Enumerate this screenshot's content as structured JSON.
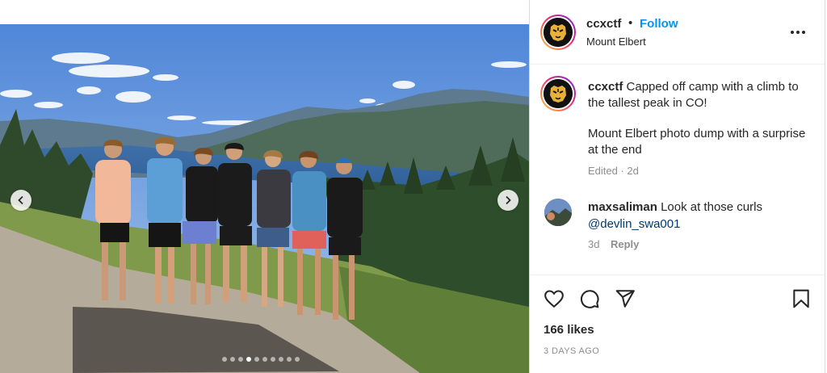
{
  "post": {
    "username": "ccxctf",
    "separator": "•",
    "follow_label": "Follow",
    "location": "Mount Elbert",
    "more_icon": "more-options-icon"
  },
  "caption": {
    "username": "ccxctf",
    "line1": "Capped off camp with a climb to the tallest peak in CO!",
    "line2": "Mount Elbert photo dump with a surprise at the end",
    "meta": "Edited · 2d"
  },
  "comment": {
    "username": "maxsaliman",
    "text": "Look at those curls",
    "mention": "@devlin_swa001",
    "age": "3d",
    "reply_label": "Reply"
  },
  "actions": {
    "icons": [
      "heart-icon",
      "comment-icon",
      "share-icon",
      "bookmark-icon"
    ],
    "likes": "166 likes",
    "date": "3 DAYS AGO"
  },
  "carousel": {
    "total_slides": 10,
    "active_index": 3
  },
  "colors": {
    "link_blue": "#0095f6",
    "mention_blue": "#00376b",
    "muted": "#8e8e8e",
    "text": "#262626",
    "border": "#dbdbdb"
  }
}
